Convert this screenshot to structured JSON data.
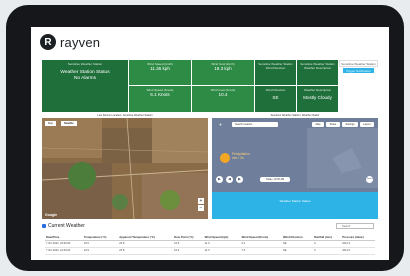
{
  "app": {
    "logo_letter": "R",
    "logo_text": "rayven"
  },
  "tiles": [
    {
      "label": "Sensitive Weather Station",
      "value": "Weather Station Status",
      "sub": "No Alarms",
      "color": "#1f6f3a"
    },
    {
      "label": "Wind Speed (km/h)",
      "value": "11.36 kph",
      "sub": "",
      "color": "#2e8b46"
    },
    {
      "label": "Wind Gust (km/h)",
      "value": "19.3 kph",
      "sub": "",
      "color": "#2e8b46"
    },
    {
      "label": "Wind Speed (Knots)",
      "value": "6.1 Knots",
      "sub": "",
      "color": "#2e8b46"
    },
    {
      "label": "Wind Gust (Knots)",
      "value": "10.4",
      "sub": "",
      "color": "#2e8b46"
    },
    {
      "label": "Sensitive Weather Station",
      "value": "Wind Direction",
      "sub": "",
      "color": "#1f6f3a"
    },
    {
      "label": "Wind Direction",
      "value": "SE",
      "sub": "",
      "color": "#1f6f3a"
    },
    {
      "label": "Sensitive Weather Station",
      "value": "Weather Description",
      "sub": "",
      "color": "#1f6f3a"
    },
    {
      "label": "Weather Description",
      "value": "Mostly Cloudy",
      "sub": "",
      "color": "#1f6f3a"
    },
    {
      "label": "Sensitive Weather Station",
      "value": "",
      "sub": "",
      "color": "#ffffff"
    },
    {
      "label": "Trigger Notification",
      "value": "",
      "sub": "",
      "color": "#2db3e6"
    }
  ],
  "satellite": {
    "title": "Live Device Location: Sensitive Weather Station",
    "tab_map": "Map",
    "tab_satellite": "Satellite",
    "attribution": "Google"
  },
  "radar": {
    "title": "Sensitive Weather Station: Weather Radar",
    "search_placeholder": "Search location",
    "btn_map": "Map",
    "btn_share": "Share",
    "btn_settings": "Settings",
    "btn_layers": "Layers",
    "precip_label": "Precipitation",
    "precip_unit": "mm / 3h",
    "date_label": "Today, 10:00 AM",
    "zoom_label": "Zoom",
    "cyan_caption": "Weather Station Status"
  },
  "weather": {
    "title": "Current Weather",
    "search_placeholder": "Search",
    "columns": [
      "Date/Time",
      "Temperature (°C)",
      "Apparent Temperature (°C)",
      "Dew Point (°C)",
      "Wind Speed (kph)",
      "Wind Speed (Knots)",
      "Wind Direction",
      "Rainfall (mm)",
      "Pressure (mbar)"
    ],
    "rows": [
      [
        "7 Oct 2022, 22:00:00",
        "23.0",
        "22.8",
        "10.6",
        "11.0",
        "6.1",
        "SE",
        "0",
        "1012.0"
      ],
      [
        "7 Oct 2022, 21:00:00",
        "22.9",
        "22.8",
        "10.6",
        "11.0",
        "7.0",
        "SE",
        "0",
        "1011.5"
      ]
    ]
  }
}
